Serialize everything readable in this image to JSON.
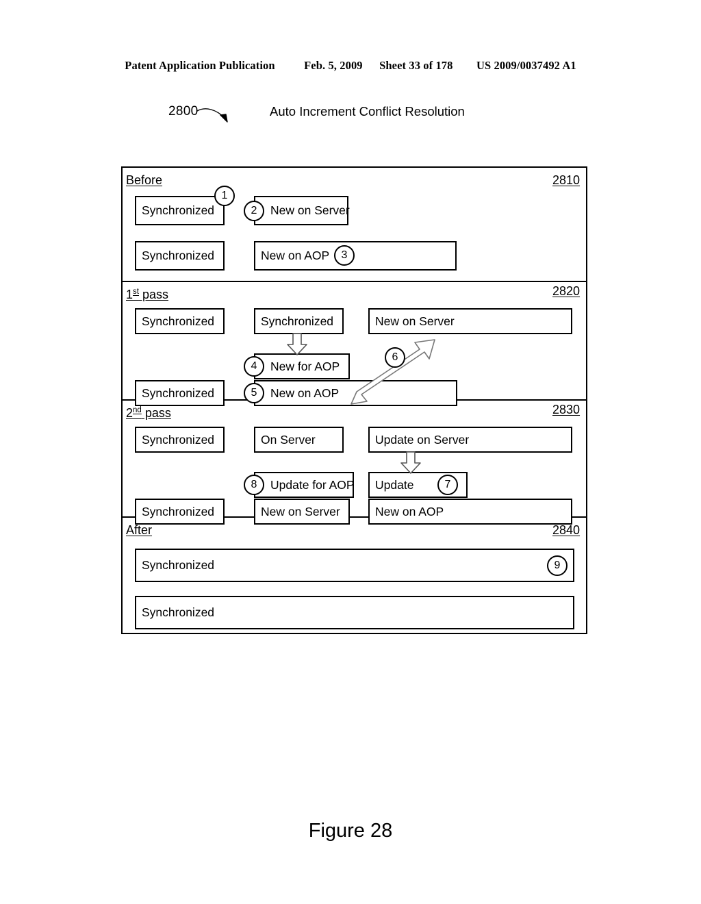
{
  "page_header": {
    "publication": "Patent Application Publication",
    "date": "Feb. 5, 2009",
    "sheet": "Sheet 33 of 178",
    "patent_number": "US 2009/0037492 A1"
  },
  "figure": {
    "reference_numeral": "2800",
    "title": "Auto Increment Conflict Resolution",
    "caption": "Figure 28"
  },
  "sections": {
    "before": {
      "label": "Before",
      "ref": "2810",
      "boxes": {
        "r1c1": "Synchronized",
        "r1c2": "New on Server",
        "r2c1": "Synchronized",
        "r2c2": "New on AOP"
      },
      "markers": {
        "m1": "1",
        "m2": "2",
        "m3": "3"
      }
    },
    "first_pass": {
      "label_main": "1",
      "label_sup": "st",
      "label_rest": " pass",
      "ref": "2820",
      "boxes": {
        "r1c1": "Synchronized",
        "r1c2": "Synchronized",
        "r1c3": "New on Server",
        "r2c2": "New for AOP",
        "r3c1": "Synchronized",
        "r3c2": "New on AOP"
      },
      "markers": {
        "m4": "4",
        "m5": "5",
        "m6": "6"
      }
    },
    "second_pass": {
      "label_main": "2",
      "label_sup": "nd",
      "label_rest": " pass",
      "ref": "2830",
      "boxes": {
        "r1c1": "Synchronized",
        "r1c2": "On Server",
        "r1c3": "Update on Server",
        "r2c2": "Update for AOP",
        "r2c3": "Update",
        "r3c1": "Synchronized",
        "r3c2": "New on Server",
        "r3c3": "New on AOP"
      },
      "markers": {
        "m7": "7",
        "m8": "8"
      }
    },
    "after": {
      "label": "After",
      "ref": "2840",
      "boxes": {
        "r1": "Synchronized",
        "r2": "Synchronized"
      },
      "markers": {
        "m9": "9"
      }
    }
  },
  "colors": {
    "ink": "#000000",
    "paper": "#ffffff"
  }
}
